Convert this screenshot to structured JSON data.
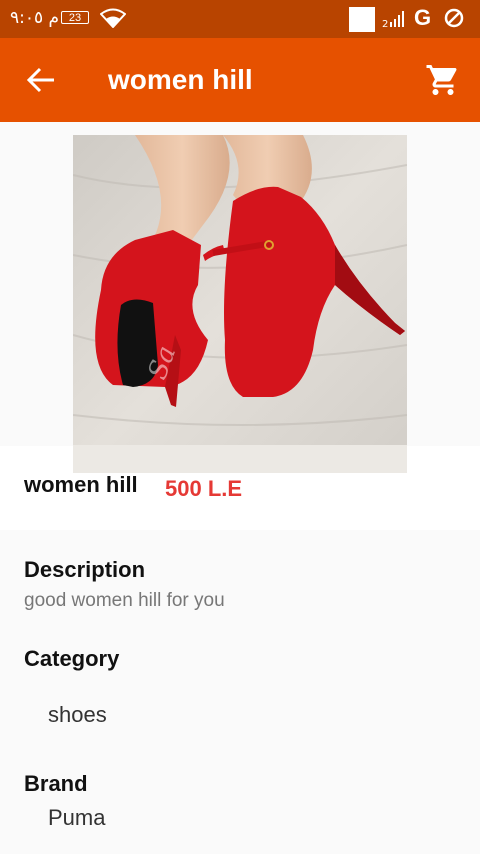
{
  "status_bar": {
    "time": "م ٩:٠٥",
    "battery": "23",
    "network": "G"
  },
  "app_bar": {
    "title": "women hill",
    "back_icon": "arrow-back-icon",
    "cart_icon": "shopping-cart-icon"
  },
  "product": {
    "name": "women hill",
    "price": "500  L.E",
    "image": "red-high-heel-shoes"
  },
  "details": {
    "description_label": "Description",
    "description_value": "good women hill for you",
    "category_label": "Category",
    "category_value": "shoes",
    "brand_label": "Brand",
    "brand_value": "Puma"
  },
  "colors": {
    "status_bar": "#b84400",
    "app_bar": "#e65100",
    "price": "#e53935",
    "shoe": "#d4141c"
  }
}
